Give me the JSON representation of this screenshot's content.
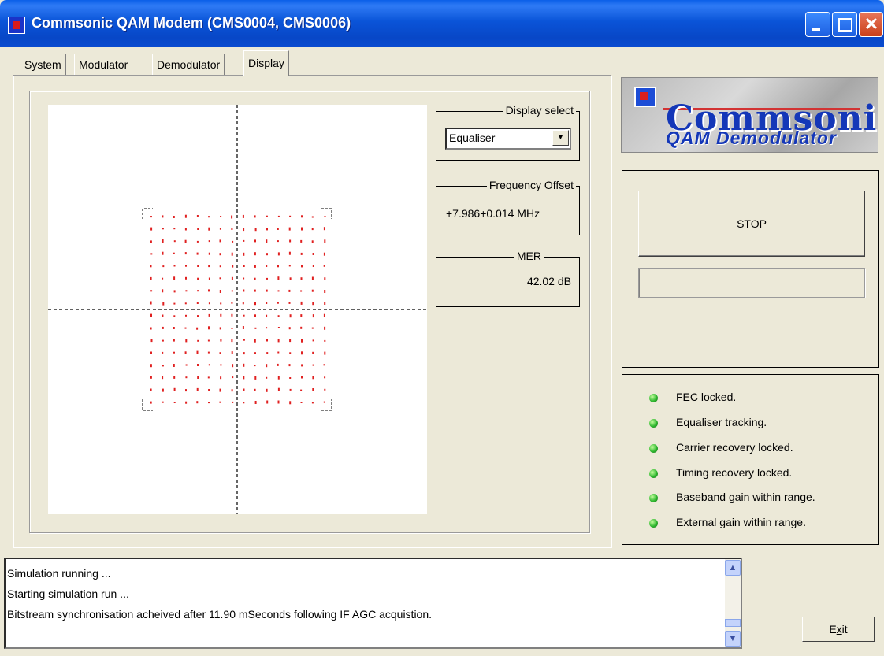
{
  "window": {
    "title": "Commsonic QAM Modem (CMS0004, CMS0006)"
  },
  "tabs": [
    {
      "label": "System"
    },
    {
      "label": "Modulator"
    },
    {
      "label": "Demodulator"
    },
    {
      "label": "Display",
      "active": true
    }
  ],
  "display_select": {
    "title": "Display select",
    "value": "Equaliser"
  },
  "frequency_offset": {
    "title": "Frequency Offset",
    "value": "+7.986+0.014 MHz"
  },
  "mer": {
    "title": "MER",
    "value": "42.02 dB"
  },
  "logo": {
    "name": "Commsonic",
    "subtitle": "QAM Demodulator"
  },
  "controls": {
    "stop_label": "STOP",
    "exit_label": "Exit",
    "exit_mnemonic": "x"
  },
  "status_items": [
    {
      "label": "FEC locked.",
      "color": "#2fb82f"
    },
    {
      "label": "Equaliser tracking.",
      "color": "#2fb82f"
    },
    {
      "label": "Carrier recovery locked.",
      "color": "#2fb82f"
    },
    {
      "label": "Timing recovery locked.",
      "color": "#2fb82f"
    },
    {
      "label": "Baseband gain within range.",
      "color": "#2fb82f"
    },
    {
      "label": "External gain within range.",
      "color": "#2fb82f"
    }
  ],
  "log": [
    "Simulation running ...",
    "Starting simulation run ...",
    "Bitstream synchronisation acheived after  11.90 mSeconds following IF AGC acquistion."
  ],
  "constellation": {
    "order": 256,
    "point_color": "#e02020",
    "axis_color": "#000000"
  }
}
